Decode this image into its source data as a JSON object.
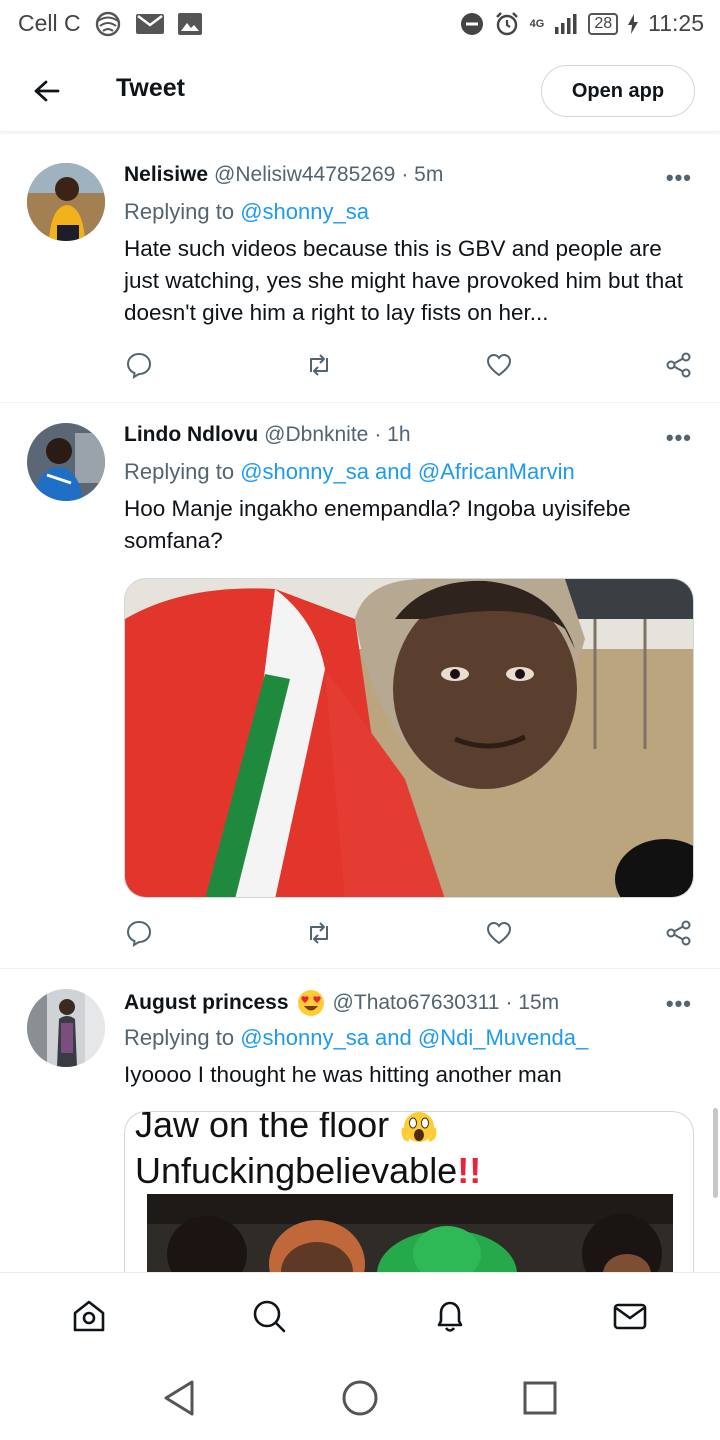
{
  "status_bar": {
    "carrier": "Cell C",
    "network": "4G",
    "battery": "28",
    "time": "11:25"
  },
  "header": {
    "title": "Tweet",
    "open_app_label": "Open app"
  },
  "tweets": [
    {
      "name": "Nelisiwe",
      "handle": "@Nelisiw44785269",
      "time": "· 5m",
      "replying_prefix": "Replying to",
      "replying_to": "@shonny_sa",
      "text": "Hate such videos because this is GBV and people are just watching, yes she might have provoked him but that doesn't give him a right to lay fists on her...",
      "more": "•••"
    },
    {
      "name": "Lindo Ndlovu",
      "handle": "@Dbnknite",
      "time": "· 1h",
      "replying_prefix": "Replying to",
      "replying_to": "@shonny_sa and @AfricanMarvin",
      "text": "Hoo Manje ingakho enempandla? Ingoba uyisifebe somfana?",
      "more": "•••"
    },
    {
      "name": "August princess",
      "emoji": "heart-eyes-emoji",
      "handle": "@Thato67630311",
      "time": "· 15m",
      "replying_prefix": "Replying to",
      "replying_to": "@shonny_sa and @Ndi_Muvenda_",
      "text": "Iyoooo I thought he was hitting another man",
      "more": "•••",
      "media_caption_1": "Jaw on the floor",
      "media_caption_2": "Unfuckingbelievable",
      "media_marks": "!!"
    }
  ],
  "icons": {
    "back": "arrow-left-icon",
    "reply": "reply-icon",
    "retweet": "retweet-icon",
    "like": "heart-icon",
    "share": "share-icon",
    "home": "home-icon",
    "search": "search-icon",
    "notifications": "bell-icon",
    "messages": "mail-icon"
  },
  "colors": {
    "accent": "#1d9bf0",
    "muted": "#536471",
    "text": "#0f1419"
  }
}
